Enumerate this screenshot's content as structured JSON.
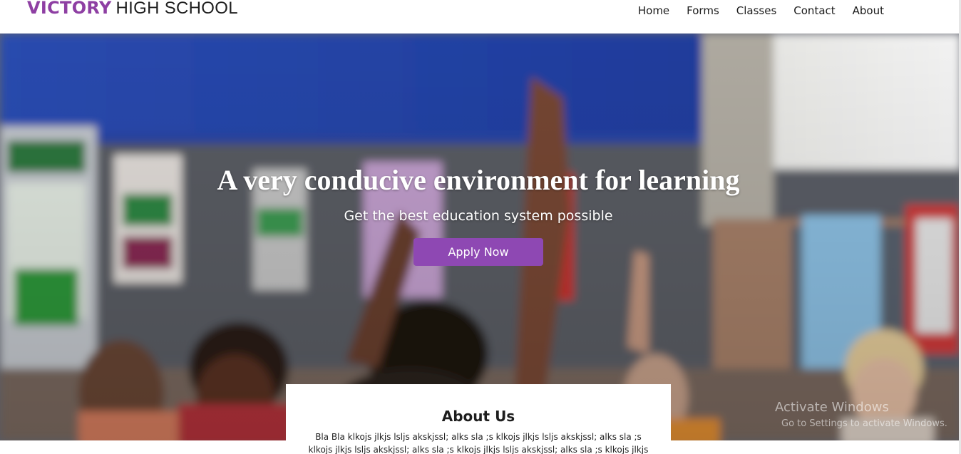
{
  "brand": {
    "accent": "VICTORY",
    "rest": "HIGH SCHOOL"
  },
  "nav": {
    "items": [
      "Home",
      "Forms",
      "Classes",
      "Contact",
      "About"
    ]
  },
  "hero": {
    "title": "A very conducive environment for learning",
    "subtitle": "Get the best education system possible",
    "cta_label": "Apply Now"
  },
  "about": {
    "title": "About Us",
    "text": "Bla Bla klkojs jlkjs lsljs akskjssl; alks sla ;s klkojs jlkjs lsljs akskjssl; alks sla ;s klkojs jlkjs lsljs akskjssl; alks sla ;s klkojs jlkjs lsljs akskjssl; alks sla ;s klkojs jlkjs lsljs"
  },
  "watermark": {
    "title": "Activate Windows",
    "subtitle": "Go to Settings to activate Windows."
  },
  "colors": {
    "accent": "#8e3fa3",
    "button": "#8e48b3",
    "hero_wall": "#2f4fb0"
  }
}
